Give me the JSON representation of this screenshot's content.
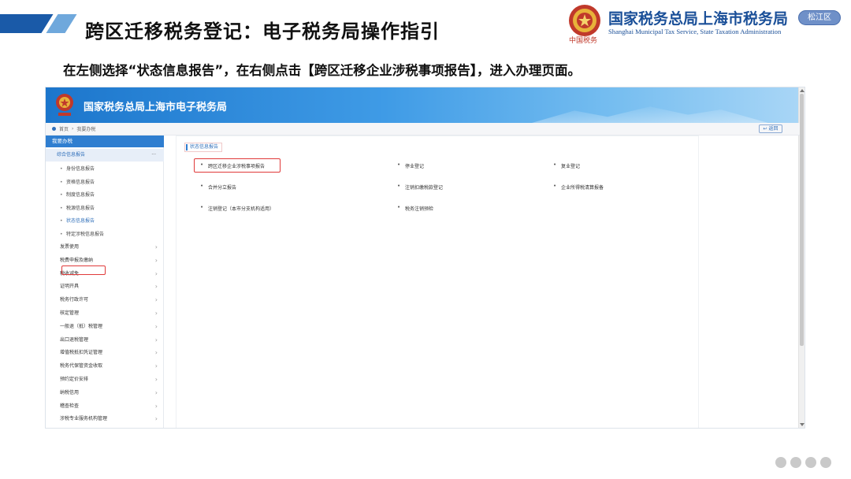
{
  "slide": {
    "title": "跨区迁移税务登记：电子税务局操作指引",
    "instruction": "在左侧选择“状态信息报告”，在右侧点击【跨区迁移企业涉税事项报告】，进入办理页面。"
  },
  "org": {
    "name_cn": "国家税务总局上海市税务局",
    "name_en": "Shanghai Municipal Tax Service, State Taxation Administration",
    "emblem_caption": "中国税务",
    "district": "松江区"
  },
  "screenshot": {
    "portal_title": "国家税务总局上海市电子税务局",
    "breadcrumb": [
      "首页",
      "我要办税"
    ],
    "back_label": "返回",
    "sidebar": {
      "header": "我要办税",
      "section": "综合信息报告",
      "section_more": "···",
      "children": [
        "身份信息报告",
        "资格信息报告",
        "制度信息报告",
        "税源信息报告",
        "状态信息报告",
        "特定涉税信息报告"
      ],
      "active_child": "状态信息报告",
      "items": [
        "发票使用",
        "税费申报及缴纳",
        "税收减免",
        "证明开具",
        "税务行政许可",
        "核定管理",
        "一般退（抵）税管理",
        "出口退税管理",
        "增值税抵扣凭证管理",
        "税务代保管资金收取",
        "预约定价安排",
        "纳税信用",
        "稽查检查",
        "涉税专业服务机构管理"
      ]
    },
    "panel": {
      "tag": "状态信息报告",
      "options": [
        "跨区迁移企业涉税事项报告",
        "停业登记",
        "复业登记",
        "合并分立报告",
        "注销扣缴税款登记",
        "企业所得税清算报备",
        "注销登记（本市分支机构适用）",
        "税务注销预检"
      ]
    }
  },
  "colors": {
    "accent": "#1a4f98",
    "highlight": "#e03a3a",
    "banner": "#2f7ed0"
  }
}
